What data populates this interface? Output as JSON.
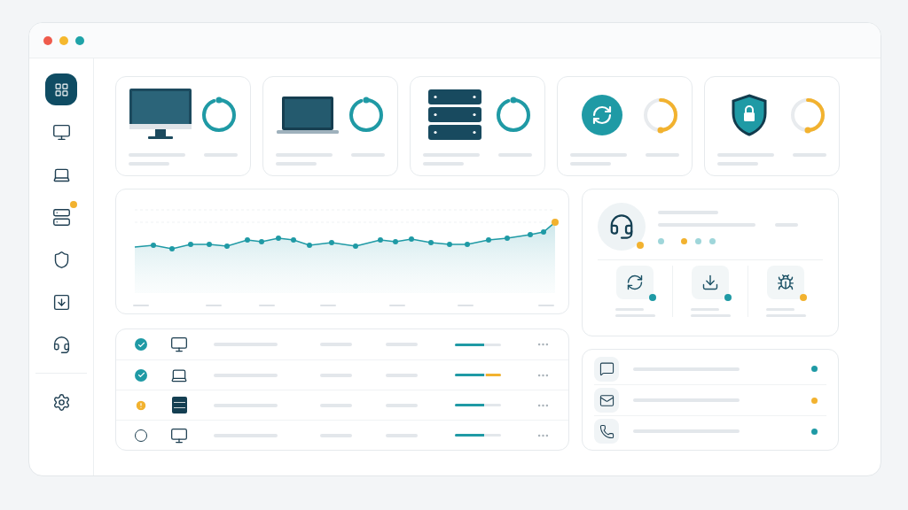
{
  "window": {
    "controls": [
      {
        "color": "#ef5b4c"
      },
      {
        "color": "#f5b82e"
      },
      {
        "color": "#1fa3a8"
      }
    ]
  },
  "sidebar": {
    "items": [
      {
        "kind": "dashboard",
        "selected": true,
        "badge": false
      },
      {
        "kind": "monitor",
        "selected": false,
        "badge": false
      },
      {
        "kind": "laptop",
        "selected": false,
        "badge": false
      },
      {
        "kind": "server",
        "selected": false,
        "badge": true
      },
      {
        "kind": "shield",
        "selected": false,
        "badge": false
      },
      {
        "kind": "download",
        "selected": false,
        "badge": false
      },
      {
        "kind": "headset",
        "selected": false,
        "badge": false
      }
    ],
    "footer_items": [
      {
        "kind": "settings",
        "selected": false,
        "badge": false
      }
    ]
  },
  "cards": [
    {
      "kind": "monitor",
      "ring": {
        "kind": "full",
        "color": "#1f9aa5"
      }
    },
    {
      "kind": "laptop",
      "ring": {
        "kind": "full",
        "color": "#1f9aa5"
      }
    },
    {
      "kind": "server",
      "ring": {
        "kind": "full",
        "color": "#1f9aa5"
      }
    },
    {
      "kind": "sync",
      "ring": {
        "kind": "half",
        "color": "#f2b22f"
      }
    },
    {
      "kind": "shield",
      "ring": {
        "kind": "half",
        "color": "#f2b22f"
      }
    }
  ],
  "support": {
    "badge": true,
    "dots": [
      {
        "color": "#9fd6da"
      },
      {
        "color": "#f2b22f"
      },
      {
        "color": "#9fd6da"
      },
      {
        "color": "#9fd6da"
      }
    ],
    "actions": [
      {
        "kind": "sync",
        "color": "#1f9aa5"
      },
      {
        "kind": "download",
        "color": "#1f9aa5"
      },
      {
        "kind": "bug",
        "color": "#f2b22f"
      }
    ]
  },
  "table": {
    "rows": [
      {
        "status": {
          "kind": "ok"
        },
        "device": {
          "kind": "monitor"
        },
        "level": 0.64,
        "warning": false
      },
      {
        "status": {
          "kind": "ok"
        },
        "device": {
          "kind": "laptop"
        },
        "level": 0.64,
        "warning": true
      },
      {
        "status": {
          "kind": "warning"
        },
        "device": {
          "kind": "server"
        },
        "level": 0.64,
        "warning": false
      },
      {
        "status": {
          "kind": "idle"
        },
        "device": {
          "kind": "monitor"
        },
        "level": 0.64,
        "warning": false
      }
    ]
  },
  "contacts": [
    {
      "kind": "chat",
      "color": "#1f9aa5"
    },
    {
      "kind": "mail",
      "color": "#f2b22f"
    },
    {
      "kind": "phone",
      "color": "#1f9aa5"
    }
  ]
}
